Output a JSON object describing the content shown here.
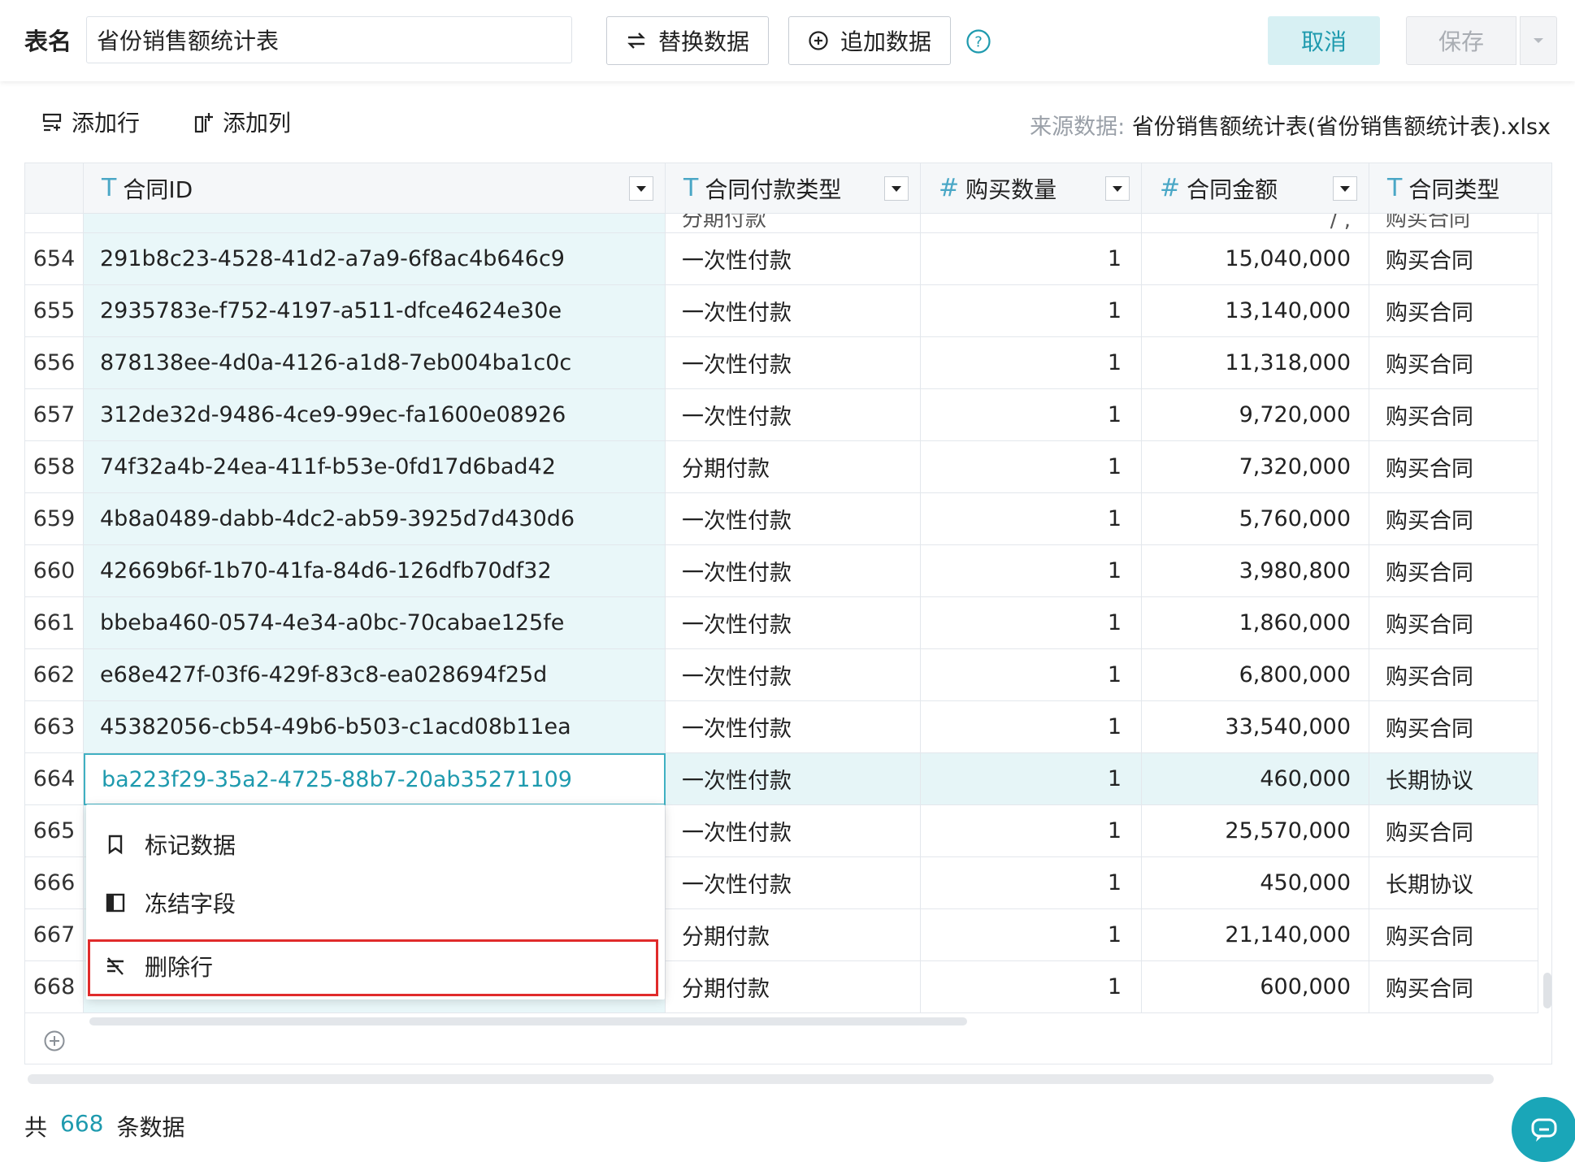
{
  "header": {
    "table_name_label": "表名",
    "table_name_value": "省份销售额统计表",
    "replace_button": "替换数据",
    "append_button": "追加数据",
    "cancel_button": "取消",
    "save_button": "保存"
  },
  "toolbar": {
    "add_row": "添加行",
    "add_column": "添加列",
    "source_label": "来源数据:",
    "source_value": "省份销售额统计表(省份销售额统计表).xlsx"
  },
  "columns": [
    {
      "label": "合同ID",
      "type_icon": "T"
    },
    {
      "label": "合同付款类型",
      "type_icon": "T"
    },
    {
      "label": "购买数量",
      "type_icon": "#"
    },
    {
      "label": "合同金额",
      "type_icon": "#"
    },
    {
      "label": "合同类型",
      "type_icon": "T"
    }
  ],
  "partial_row": {
    "pay": "分期付款",
    "amount": "/ ,",
    "type": "购买合同"
  },
  "rows": [
    {
      "num": "654",
      "id": "291b8c23-4528-41d2-a7a9-6f8ac4b646c9",
      "pay": "一次性付款",
      "qty": "1",
      "amount": "15,040,000",
      "type": "购买合同"
    },
    {
      "num": "655",
      "id": "2935783e-f752-4197-a511-dfce4624e30e",
      "pay": "一次性付款",
      "qty": "1",
      "amount": "13,140,000",
      "type": "购买合同"
    },
    {
      "num": "656",
      "id": "878138ee-4d0a-4126-a1d8-7eb004ba1c0c",
      "pay": "一次性付款",
      "qty": "1",
      "amount": "11,318,000",
      "type": "购买合同"
    },
    {
      "num": "657",
      "id": "312de32d-9486-4ce9-99ec-fa1600e08926",
      "pay": "一次性付款",
      "qty": "1",
      "amount": "9,720,000",
      "type": "购买合同"
    },
    {
      "num": "658",
      "id": "74f32a4b-24ea-411f-b53e-0fd17d6bad42",
      "pay": "分期付款",
      "qty": "1",
      "amount": "7,320,000",
      "type": "购买合同"
    },
    {
      "num": "659",
      "id": "4b8a0489-dabb-4dc2-ab59-3925d7d430d6",
      "pay": "一次性付款",
      "qty": "1",
      "amount": "5,760,000",
      "type": "购买合同"
    },
    {
      "num": "660",
      "id": "42669b6f-1b70-41fa-84d6-126dfb70df32",
      "pay": "一次性付款",
      "qty": "1",
      "amount": "3,980,800",
      "type": "购买合同"
    },
    {
      "num": "661",
      "id": "bbeba460-0574-4e34-a0bc-70cabae125fe",
      "pay": "一次性付款",
      "qty": "1",
      "amount": "1,860,000",
      "type": "购买合同"
    },
    {
      "num": "662",
      "id": "e68e427f-03f6-429f-83c8-ea028694f25d",
      "pay": "一次性付款",
      "qty": "1",
      "amount": "6,800,000",
      "type": "购买合同"
    },
    {
      "num": "663",
      "id": "45382056-cb54-49b6-b503-c1acd08b11ea",
      "pay": "一次性付款",
      "qty": "1",
      "amount": "33,540,000",
      "type": "购买合同"
    },
    {
      "num": "664",
      "id": "ba223f29-35a2-4725-88b7-20ab35271109",
      "pay": "一次性付款",
      "qty": "1",
      "amount": "460,000",
      "type": "长期协议",
      "selected": true
    },
    {
      "num": "665",
      "id": "",
      "pay": "一次性付款",
      "qty": "1",
      "amount": "25,570,000",
      "type": "购买合同"
    },
    {
      "num": "666",
      "id": "",
      "pay": "一次性付款",
      "qty": "1",
      "amount": "450,000",
      "type": "长期协议"
    },
    {
      "num": "667",
      "id": "",
      "pay": "分期付款",
      "qty": "1",
      "amount": "21,140,000",
      "type": "购买合同"
    },
    {
      "num": "668",
      "id": "",
      "pay": "分期付款",
      "qty": "1",
      "amount": "600,000",
      "type": "购买合同"
    }
  ],
  "context_menu": {
    "mark_data": "标记数据",
    "freeze_field": "冻结字段",
    "delete_row": "删除行"
  },
  "footer": {
    "prefix": "共",
    "count": "668",
    "suffix": "条数据"
  },
  "colors": {
    "accent": "#1e9aae",
    "id_column_bg": "#e9f7f9",
    "highlight_border": "#e02b2b"
  }
}
